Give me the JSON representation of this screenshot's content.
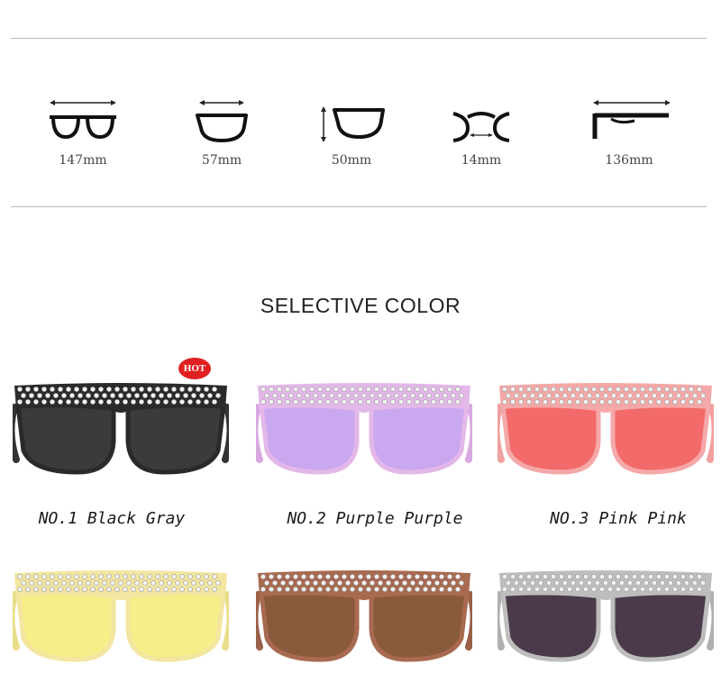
{
  "measurements": [
    {
      "name": "frame-width",
      "value": "147mm"
    },
    {
      "name": "lens-width",
      "value": "57mm"
    },
    {
      "name": "lens-height",
      "value": "50mm"
    },
    {
      "name": "bridge-width",
      "value": "14mm"
    },
    {
      "name": "temple-length",
      "value": "136mm"
    }
  ],
  "section_title": "SELECTIVE COLOR",
  "hot_badge": "HOT",
  "products": [
    {
      "label": "NO.1 Black Gray",
      "frame": "#2a2a2a",
      "lens": "#3b3b3b",
      "temple": "#333333"
    },
    {
      "label": "NO.2 Purple Purple",
      "frame": "#e3b8e8",
      "lens": "#c9a8f0",
      "temple": "#d8a8e0"
    },
    {
      "label": "NO.3 Pink Pink",
      "frame": "#f5a8a8",
      "lens": "#f26a6a",
      "temple": "#f0a0a0"
    },
    {
      "frame": "#f2e6a0",
      "lens": "#f6ee88",
      "temple": "#eadd8a"
    },
    {
      "frame": "#a86a50",
      "lens": "#8a5a3c",
      "temple": "#9a6048"
    },
    {
      "frame": "#bdbdbd",
      "lens": "#4a3a4a",
      "temple": "#b0b0b0"
    }
  ]
}
